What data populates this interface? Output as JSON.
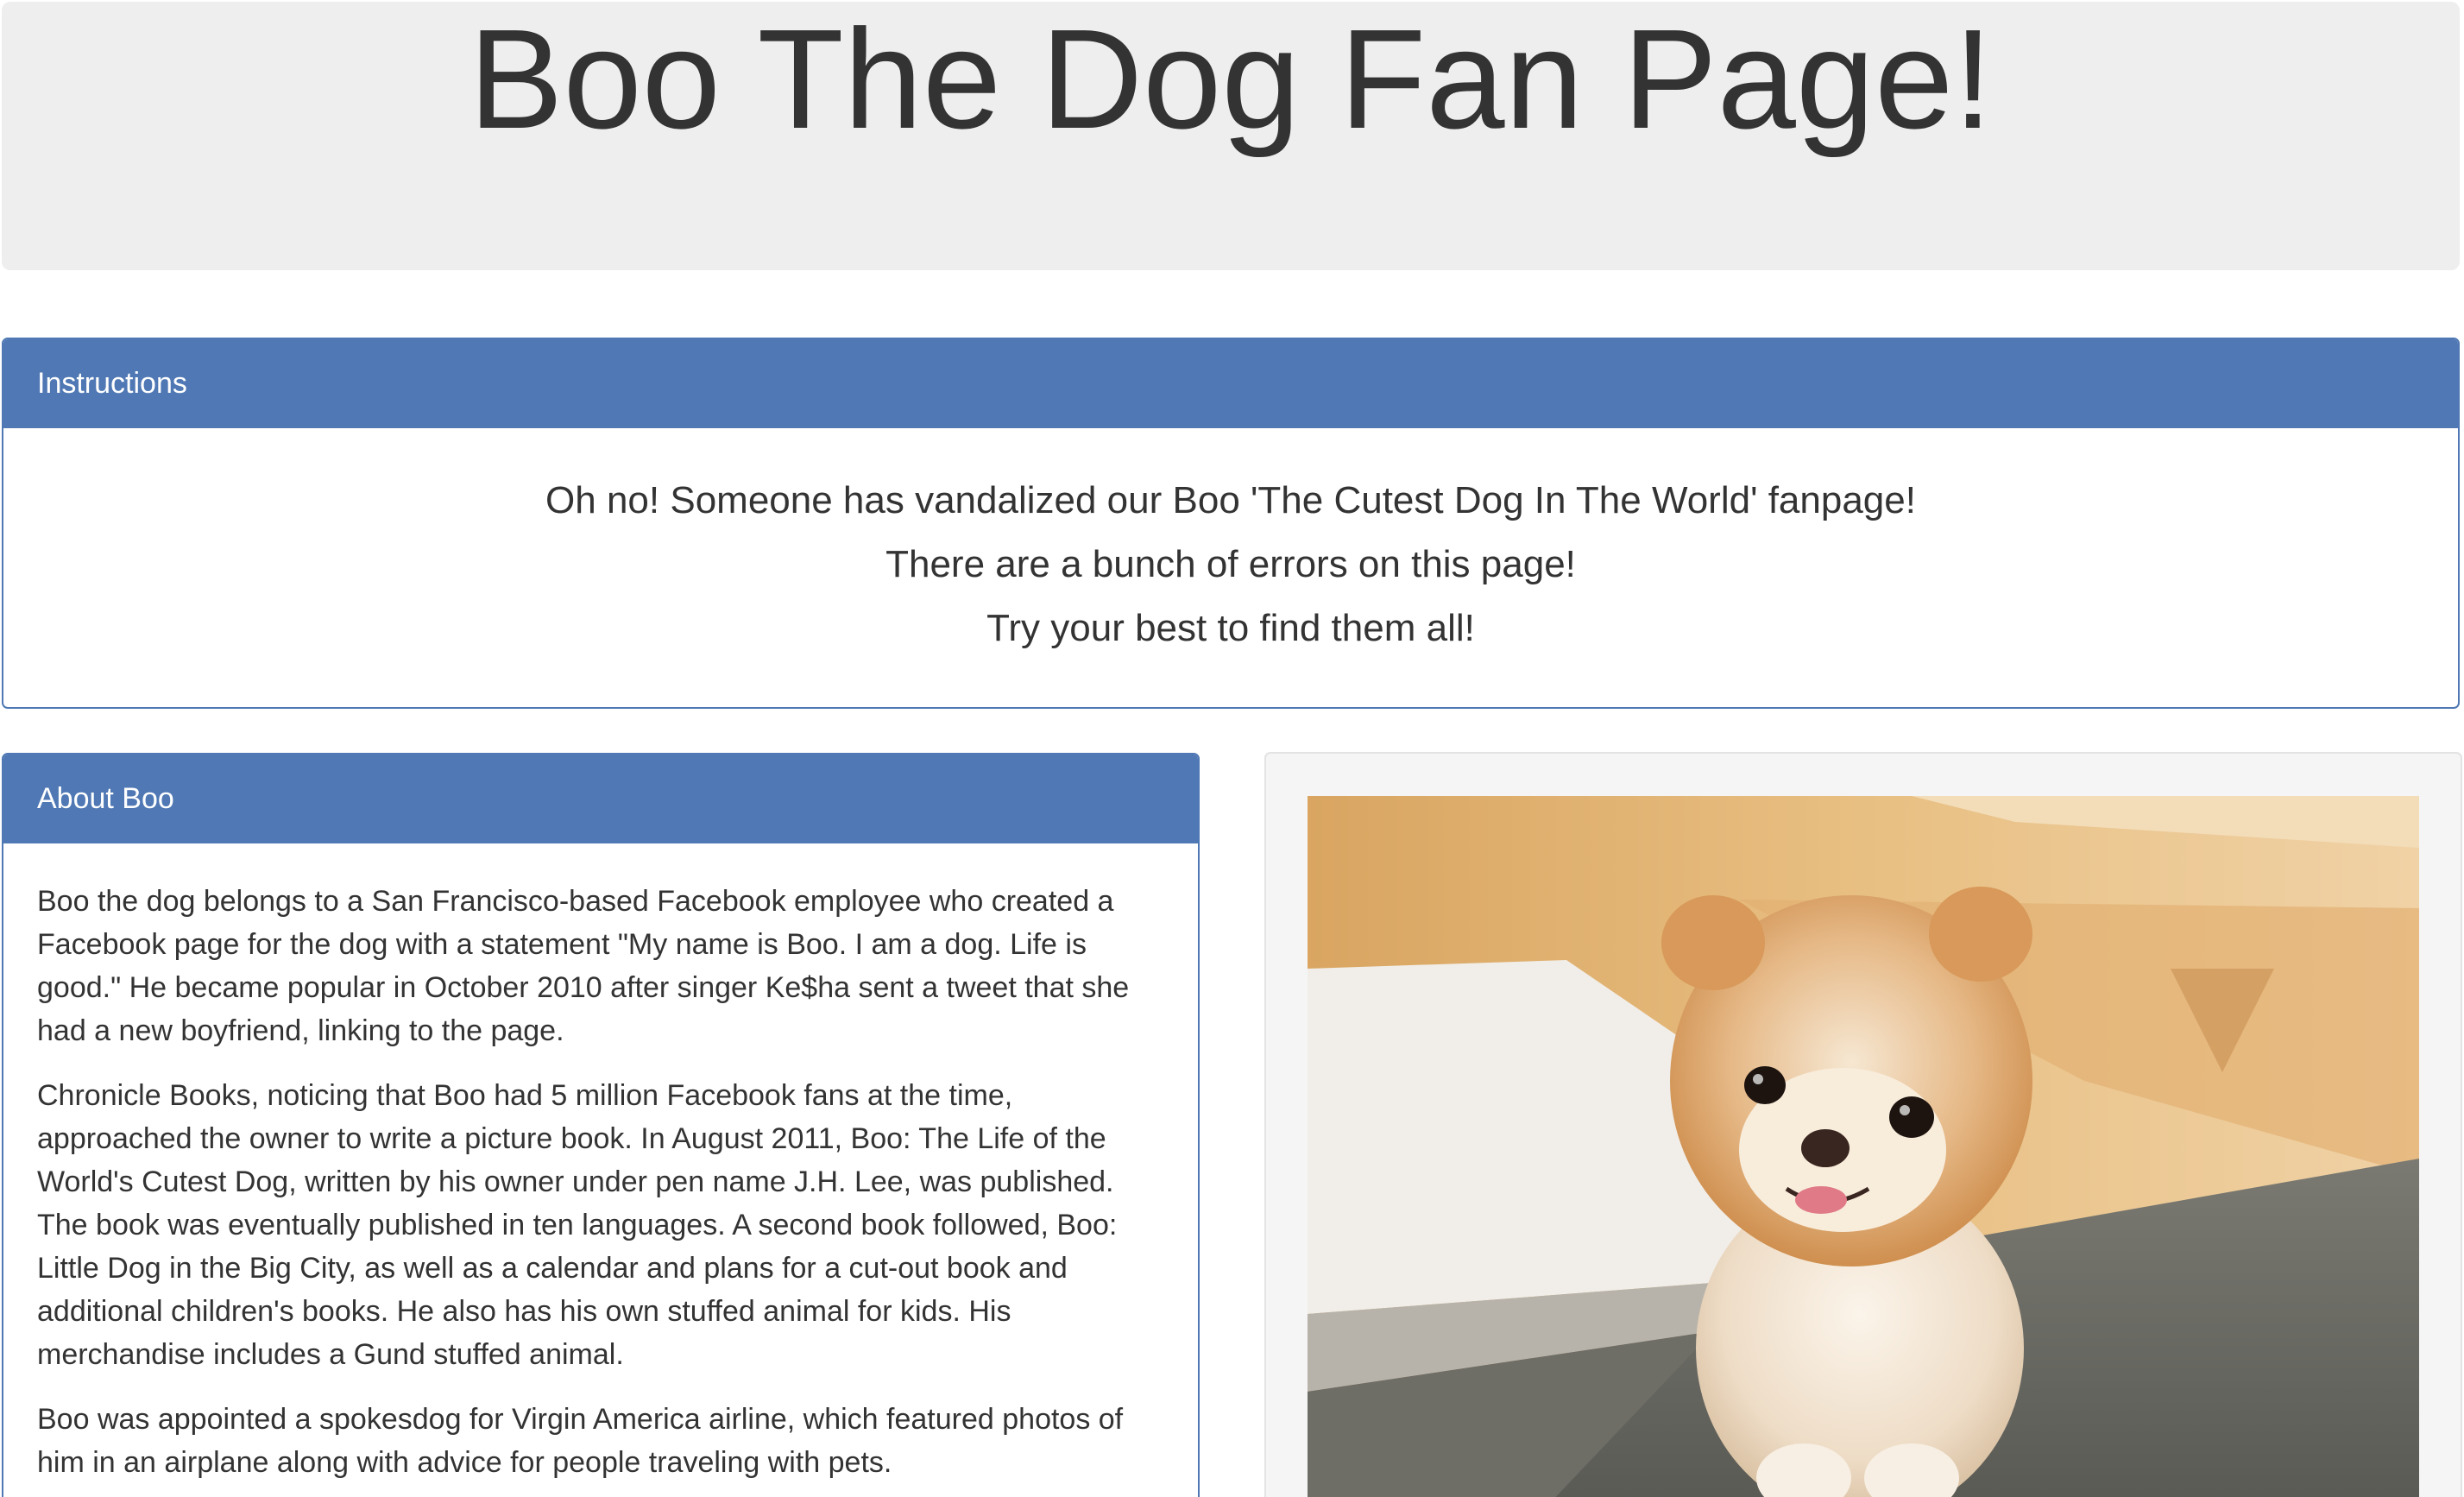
{
  "header": {
    "title": "Boo The Dog Fan Page!"
  },
  "instructions": {
    "heading": "Instructions",
    "lines": [
      "Oh no! Someone has vandalized our Boo 'The Cutest Dog In The World' fanpage!",
      "There are a bunch of errors on this page!",
      "Try your best to find them all!"
    ]
  },
  "about": {
    "heading": "About Boo",
    "paragraphs": [
      "Boo the dog belongs to a San Francisco-based Facebook employee who created a Facebook page for the dog with a statement \"My name is Boo. I am a dog. Life is good.\" He became popular in October 2010 after singer Ke$ha sent a tweet that she had a new boyfriend, linking to the page.",
      "Chronicle Books, noticing that Boo had 5 million Facebook fans at the time, approached the owner to write a picture book. In August 2011, Boo: The Life of the World's Cutest Dog, written by his owner under pen name J.H. Lee, was published. The book was eventually published in ten languages. A second book followed, Boo: Little Dog in the Big City, as well as a calendar and plans for a cut-out book and additional children's books. He also has his own stuffed animal for kids. His merchandise includes a Gund stuffed animal.",
      "Boo was appointed a spokesdog for Virgin America airline, which featured photos of him in an airplane along with advice for people traveling with pets."
    ]
  },
  "photo": {
    "subject": "pomeranian-dog-photo"
  },
  "colors": {
    "panel_primary": "#4f78b4",
    "jumbotron_bg": "#eeeeee",
    "well_bg": "#f5f5f5",
    "text": "#333333"
  }
}
